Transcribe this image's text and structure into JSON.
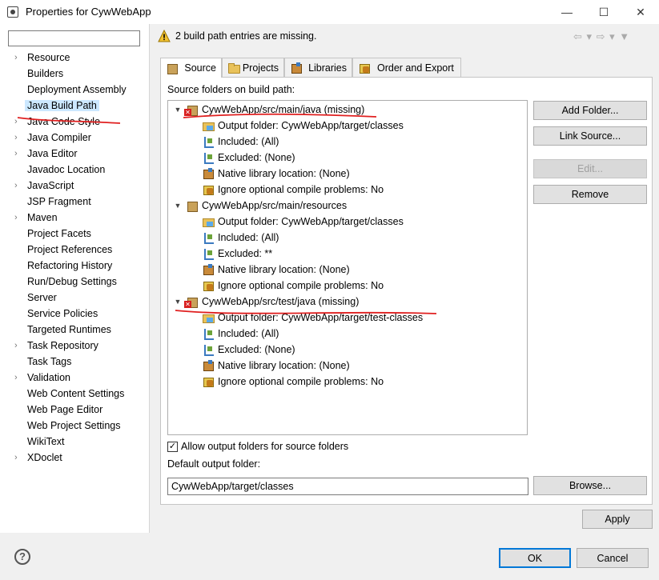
{
  "window": {
    "title": "Properties for CywWebApp",
    "minimize_glyph": "—",
    "maximize_glyph": "☐",
    "close_glyph": "✕"
  },
  "sidebar": {
    "filter_value": "",
    "items": [
      {
        "label": "Resource",
        "expandable": true
      },
      {
        "label": "Builders",
        "expandable": false
      },
      {
        "label": "Deployment Assembly",
        "expandable": false
      },
      {
        "label": "Java Build Path",
        "expandable": false,
        "selected": true
      },
      {
        "label": "Java Code Style",
        "expandable": true
      },
      {
        "label": "Java Compiler",
        "expandable": true
      },
      {
        "label": "Java Editor",
        "expandable": true
      },
      {
        "label": "Javadoc Location",
        "expandable": false
      },
      {
        "label": "JavaScript",
        "expandable": true
      },
      {
        "label": "JSP Fragment",
        "expandable": false
      },
      {
        "label": "Maven",
        "expandable": true
      },
      {
        "label": "Project Facets",
        "expandable": false
      },
      {
        "label": "Project References",
        "expandable": false
      },
      {
        "label": "Refactoring History",
        "expandable": false
      },
      {
        "label": "Run/Debug Settings",
        "expandable": false
      },
      {
        "label": "Server",
        "expandable": false
      },
      {
        "label": "Service Policies",
        "expandable": false
      },
      {
        "label": "Targeted Runtimes",
        "expandable": false
      },
      {
        "label": "Task Repository",
        "expandable": true
      },
      {
        "label": "Task Tags",
        "expandable": false
      },
      {
        "label": "Validation",
        "expandable": true
      },
      {
        "label": "Web Content Settings",
        "expandable": false
      },
      {
        "label": "Web Page Editor",
        "expandable": false
      },
      {
        "label": "Web Project Settings",
        "expandable": false
      },
      {
        "label": "WikiText",
        "expandable": false
      },
      {
        "label": "XDoclet",
        "expandable": true
      }
    ]
  },
  "header": {
    "message": "2 build path entries are missing.",
    "nav_arrows": "⇦ ▾ ⇨ ▾ ▼"
  },
  "tabs": [
    {
      "label": "Source",
      "icon": "source-icon",
      "active": true
    },
    {
      "label": "Projects",
      "icon": "projects-icon"
    },
    {
      "label": "Libraries",
      "icon": "libraries-icon"
    },
    {
      "label": "Order and Export",
      "icon": "order-icon"
    }
  ],
  "source": {
    "label": "Source folders on build path:",
    "tree": [
      {
        "label": "CywWebApp/src/main/java (missing)",
        "missing": true,
        "children": [
          {
            "icon": "out",
            "label": "Output folder: CywWebApp/target/classes"
          },
          {
            "icon": "flt",
            "label": "Included: (All)"
          },
          {
            "icon": "flt",
            "label": "Excluded: (None)"
          },
          {
            "icon": "lib",
            "label": "Native library location: (None)"
          },
          {
            "icon": "warn",
            "label": "Ignore optional compile problems: No"
          }
        ]
      },
      {
        "label": "CywWebApp/src/main/resources",
        "missing": false,
        "children": [
          {
            "icon": "out",
            "label": "Output folder: CywWebApp/target/classes"
          },
          {
            "icon": "flt",
            "label": "Included: (All)"
          },
          {
            "icon": "flt",
            "label": "Excluded: **"
          },
          {
            "icon": "lib",
            "label": "Native library location: (None)"
          },
          {
            "icon": "warn",
            "label": "Ignore optional compile problems: No"
          }
        ]
      },
      {
        "label": "CywWebApp/src/test/java (missing)",
        "missing": true,
        "children": [
          {
            "icon": "out",
            "label": "Output folder: CywWebApp/target/test-classes"
          },
          {
            "icon": "flt",
            "label": "Included: (All)"
          },
          {
            "icon": "flt",
            "label": "Excluded: (None)"
          },
          {
            "icon": "lib",
            "label": "Native library location: (None)"
          },
          {
            "icon": "warn",
            "label": "Ignore optional compile problems: No"
          }
        ]
      }
    ],
    "buttons": {
      "add_folder": "Add Folder...",
      "link_source": "Link Source...",
      "edit": "Edit...",
      "remove": "Remove"
    },
    "allow_output": {
      "label": "Allow output folders for source folders",
      "checked": true,
      "check_glyph": "✓"
    },
    "default_output": {
      "label": "Default output folder:",
      "value": "CywWebApp/target/classes",
      "browse": "Browse..."
    }
  },
  "footer": {
    "apply": "Apply",
    "ok": "OK",
    "cancel": "Cancel",
    "help_glyph": "?"
  },
  "colors": {
    "selection": "#cce8ff",
    "annotation": "#e02020",
    "default_border": "#0078d7"
  }
}
